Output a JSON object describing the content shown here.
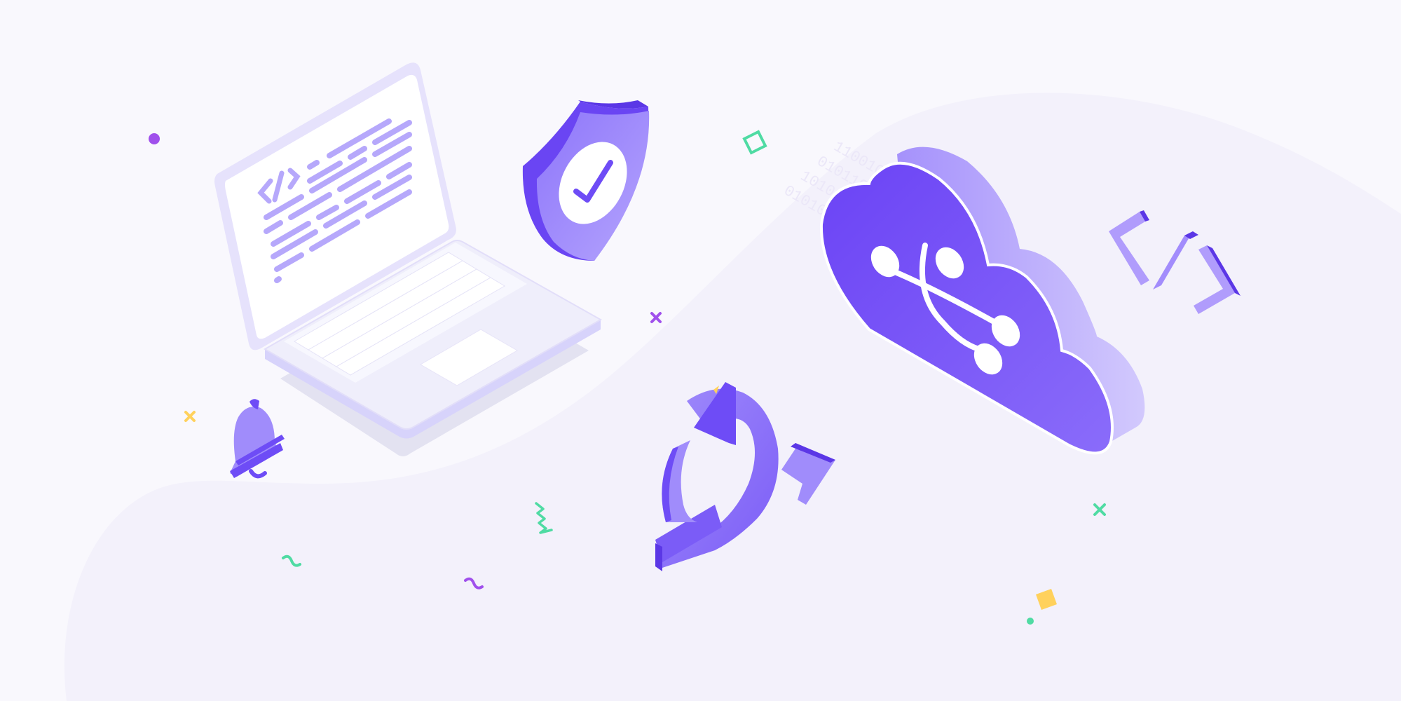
{
  "illustration": {
    "palette": {
      "background": "#f9f8fd",
      "blob": "#f3f1fb",
      "primary": "#6e4cf6",
      "primary_dark": "#5a37e8",
      "primary_light": "#a28cfc",
      "lavender": "#c4b8fc",
      "laptop_body": "#eeeefb",
      "laptop_edge": "#d7d3fb",
      "screen": "#ffffff",
      "confetti_green": "#4fdba3",
      "confetti_yellow": "#ffd15c",
      "confetti_purple": "#a050ec"
    },
    "icons": [
      "laptop-code-icon",
      "shield-check-icon",
      "cloud-git-icon",
      "code-brackets-icon",
      "bell-icon",
      "sync-arrow-icon"
    ]
  }
}
